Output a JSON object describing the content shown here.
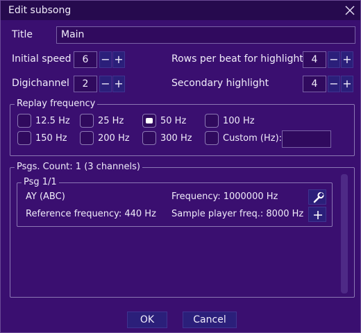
{
  "window": {
    "title": "Edit subsong",
    "close_icon": "close-icon"
  },
  "fields": {
    "title_label": "Title",
    "title_value": "Main",
    "initial_speed_label": "Initial speed",
    "initial_speed_value": "6",
    "digichannel_label": "Digichannel",
    "digichannel_value": "2",
    "rows_per_beat_label": "Rows per beat for highlight",
    "rows_per_beat_value": "4",
    "secondary_highlight_label": "Secondary highlight",
    "secondary_highlight_value": "4",
    "minus": "−",
    "plus": "+"
  },
  "replay": {
    "title": "Replay frequency",
    "options": [
      {
        "label": "12.5 Hz",
        "checked": false
      },
      {
        "label": "25 Hz",
        "checked": false
      },
      {
        "label": "50 Hz",
        "checked": true
      },
      {
        "label": "100 Hz",
        "checked": false
      },
      {
        "label": "150 Hz",
        "checked": false
      },
      {
        "label": "200 Hz",
        "checked": false
      },
      {
        "label": "300 Hz",
        "checked": false
      },
      {
        "label": "Custom (Hz):",
        "checked": false
      }
    ],
    "custom_value": ""
  },
  "psgs": {
    "title": "Psgs. Count: 1 (3 channels)",
    "psg": {
      "title": "Psg 1/1",
      "type": "AY (ABC)",
      "frequency": "Frequency: 1000000 Hz",
      "reference_frequency": "Reference frequency: 440 Hz",
      "sample_player_freq": "Sample player freq.: 8000 Hz",
      "edit_icon": "wrench-icon",
      "add_icon": "plus-icon"
    }
  },
  "buttons": {
    "ok": "OK",
    "cancel": "Cancel"
  }
}
